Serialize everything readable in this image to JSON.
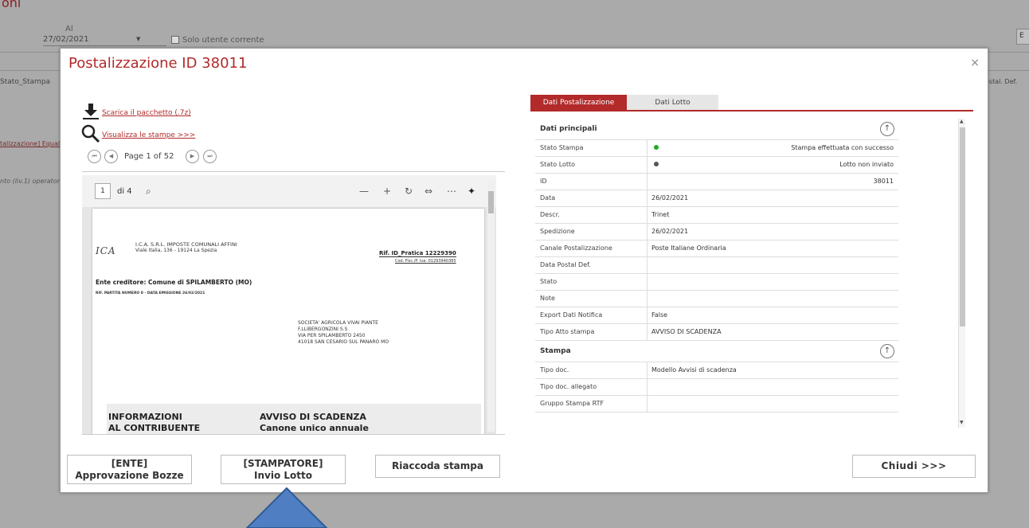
{
  "background": {
    "title_fragment": "oni",
    "al_label": "Al",
    "date_value": "27/02/2021",
    "checkbox_label": "Solo utente corrente",
    "col_header": "Stato_Stampa",
    "right_col_header": "ostal. Def.",
    "link_fragment": "talizzazione] Equal",
    "operator_fragment": "nto (liv.1) operator",
    "right_button": "E"
  },
  "modal": {
    "title": "Postalizzazione ID 38011",
    "close": "×",
    "download_link": "Scarica il pacchetto (.7z)",
    "view_link": "Visualizza le stampe >>>",
    "pager_text": "Page 1 of 52"
  },
  "viewer": {
    "page_input": "1",
    "page_of": "di 4",
    "document": {
      "company": "I.C.A. S.R.L. IMPOSTE COMUNALI AFFINI",
      "address": "Viale Italia, 136 - 19124 La Spezia",
      "ref": "Rif. ID_Pratica 12229390",
      "fiscal": "Cod. Fisc./P. Iva: 01293940365",
      "creditor": "Ente creditore: Comune di SPILAMBERTO (MO)",
      "ref_line": "RIF. PARTITA NUMERO 8 - DATA EMISSIONE 26/02/2021",
      "recipient": [
        "SOCIETA' AGRICOLA VIVAI PIANTE",
        "F.LLIBERGONZINI S.S",
        "VIA PER SPILAMBERTO 2450",
        "41018 SAN CESARIO SUL PANARO MO"
      ],
      "info_heading": "INFORMAZIONI",
      "info_sub": "AL CONTRIBUENTE",
      "notice_heading": "AVVISO DI SCADENZA",
      "notice_sub": "Canone unico annuale"
    }
  },
  "tabs": [
    "Dati Postalizzazione",
    "Dati Lotto"
  ],
  "details": {
    "section1": "Dati principali",
    "rows1": [
      {
        "label": "Stato Stampa",
        "value": "Stampa effettuata con successo",
        "status": "green"
      },
      {
        "label": "Stato Lotto",
        "value": "Lotto non inviato",
        "status": "gray"
      },
      {
        "label": "ID",
        "value": "38011"
      },
      {
        "label": "Data",
        "value": "26/02/2021"
      },
      {
        "label": "Descr.",
        "value": "Trinet"
      },
      {
        "label": "Spedizione",
        "value": "26/02/2021"
      },
      {
        "label": "Canale Postalizzazione",
        "value": "Poste Italiane Ordinaria"
      },
      {
        "label": "Data Postal Def.",
        "value": ""
      },
      {
        "label": "Stato",
        "value": ""
      },
      {
        "label": "Note",
        "value": ""
      },
      {
        "label": "Export Dati Notifica",
        "value": "False"
      },
      {
        "label": "Tipo Atto stampa",
        "value": "AVVISO DI SCADENZA"
      }
    ],
    "section2": "Stampa",
    "rows2": [
      {
        "label": "Tipo doc.",
        "value": "Modello Avvisi di scadenza"
      },
      {
        "label": "Tipo doc. allegato",
        "value": ""
      },
      {
        "label": "Gruppo Stampa RTF",
        "value": ""
      }
    ]
  },
  "buttons": {
    "ente_line1": "[ENTE]",
    "ente_line2": "Approvazione Bozze",
    "stamp_line1": "[STAMPATORE]",
    "stamp_line2": "Invio Lotto",
    "riaccoda": "Riaccoda stampa",
    "chiudi": "Chiudi >>>"
  },
  "colors": {
    "accent": "#b22a2a",
    "status_green": "#22aa22",
    "status_gray": "#555555",
    "arrow_fill": "#4f7ec2"
  }
}
